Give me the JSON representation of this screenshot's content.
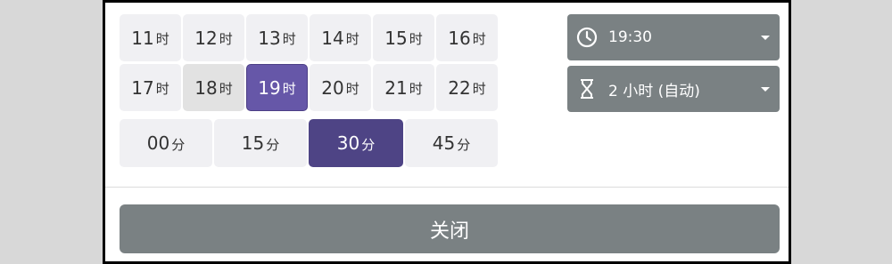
{
  "hours_row1": [
    {
      "num": "11",
      "unit": "时"
    },
    {
      "num": "12",
      "unit": "时"
    },
    {
      "num": "13",
      "unit": "时"
    },
    {
      "num": "14",
      "unit": "时"
    },
    {
      "num": "15",
      "unit": "时"
    },
    {
      "num": "16",
      "unit": "时"
    }
  ],
  "hours_row2": [
    {
      "num": "17",
      "unit": "时"
    },
    {
      "num": "18",
      "unit": "时"
    },
    {
      "num": "19",
      "unit": "时"
    },
    {
      "num": "20",
      "unit": "时"
    },
    {
      "num": "21",
      "unit": "时"
    },
    {
      "num": "22",
      "unit": "时"
    }
  ],
  "minutes": [
    {
      "num": "00",
      "unit": "分"
    },
    {
      "num": "15",
      "unit": "分"
    },
    {
      "num": "30",
      "unit": "分"
    },
    {
      "num": "45",
      "unit": "分"
    }
  ],
  "selected_hour": "19",
  "hovered_hour": "18",
  "selected_minute": "30",
  "time_select": {
    "value": "19:30",
    "icon": "clock-icon"
  },
  "duration_select": {
    "value": "2 小时 (自动)",
    "icon": "hourglass-icon"
  },
  "close_label": "关闭",
  "colors": {
    "accent_hour": "#6657a8",
    "accent_minute": "#4e4485",
    "control_gray": "#7a8183"
  }
}
